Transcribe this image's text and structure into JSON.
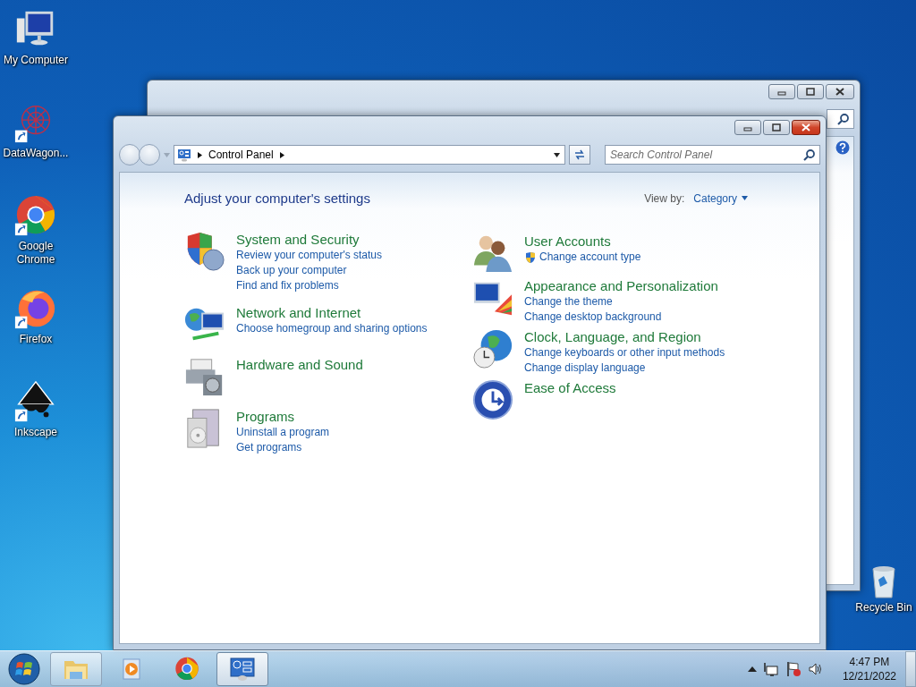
{
  "desktop_icons": [
    {
      "label": "My Computer",
      "kind": "computer",
      "shortcut": false
    },
    {
      "label": "DataWagon...",
      "kind": "network-graph",
      "shortcut": true
    },
    {
      "label": "Google Chrome",
      "kind": "chrome",
      "shortcut": true
    },
    {
      "label": "Firefox",
      "kind": "firefox",
      "shortcut": true
    },
    {
      "label": "Inkscape",
      "kind": "inkscape",
      "shortcut": true
    }
  ],
  "recycle_bin": {
    "label": "Recycle Bin"
  },
  "window": {
    "breadcrumb": [
      "Control Panel"
    ],
    "search": {
      "placeholder": "Search Control Panel"
    },
    "heading": "Adjust your computer's settings",
    "view_by": {
      "label": "View by:",
      "value": "Category"
    },
    "columns": [
      [
        {
          "title": "System and Security",
          "kind": "security",
          "links": [
            {
              "text": "Review your computer's status",
              "shield": false
            },
            {
              "text": "Back up your computer",
              "shield": false
            },
            {
              "text": "Find and fix problems",
              "shield": false
            }
          ]
        },
        {
          "title": "Network and Internet",
          "kind": "network",
          "links": [
            {
              "text": "Choose homegroup and sharing options",
              "shield": false
            }
          ]
        },
        {
          "title": "Hardware and Sound",
          "kind": "hardware"
        },
        {
          "title": "Programs",
          "kind": "programs",
          "links": [
            {
              "text": "Uninstall a program",
              "shield": false
            },
            {
              "text": "Get programs",
              "shield": false
            }
          ]
        }
      ],
      [
        {
          "title": "User Accounts",
          "kind": "users",
          "links": [
            {
              "text": "Change account type",
              "shield": true
            }
          ]
        },
        {
          "title": "Appearance and Personalization",
          "kind": "appearance",
          "links": [
            {
              "text": "Change the theme",
              "shield": false
            },
            {
              "text": "Change desktop background",
              "shield": false
            }
          ]
        },
        {
          "title": "Clock, Language, and Region",
          "kind": "clock",
          "links": [
            {
              "text": "Change keyboards or other input methods",
              "shield": false
            },
            {
              "text": "Change display language",
              "shield": false
            }
          ]
        },
        {
          "title": "Ease of Access",
          "kind": "access"
        }
      ]
    ]
  },
  "taskbar": {
    "items": [
      {
        "kind": "explorer",
        "running": true,
        "selected": false
      },
      {
        "kind": "media",
        "running": false,
        "selected": false
      },
      {
        "kind": "chrome",
        "running": false,
        "selected": false
      },
      {
        "kind": "control-panel",
        "running": true,
        "selected": true
      }
    ],
    "time": "4:47 PM",
    "date": "12/21/2022"
  }
}
